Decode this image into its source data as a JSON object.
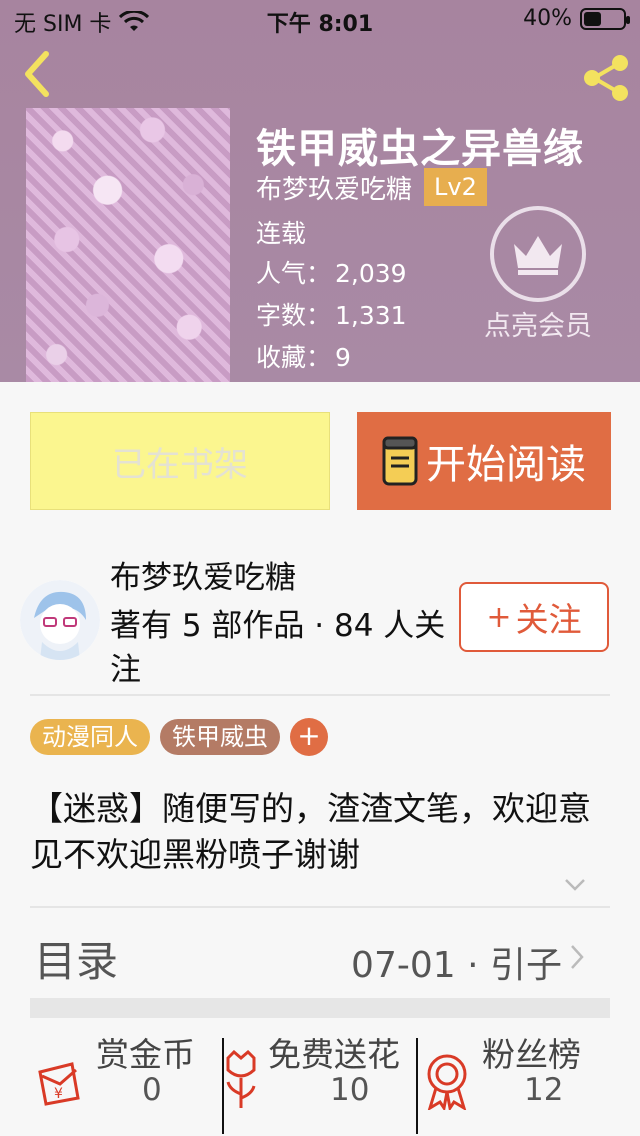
{
  "status_bar": {
    "carrier": "无 SIM 卡",
    "time": "下午 8:01",
    "battery": "40%",
    "battery_level": 0.4
  },
  "book": {
    "title": "铁甲威虫之异兽缘",
    "author": "布梦玖爱吃糖",
    "level": "Lv2",
    "status": "连载",
    "popularity_label": "人气：",
    "popularity": "2,039",
    "words_label": "字数：",
    "words": "1,331",
    "favorites_label": "收藏：",
    "favorites": "9"
  },
  "vip": {
    "label": "点亮会员"
  },
  "actions": {
    "shelf_label": "已在书架",
    "read_label": "开始阅读"
  },
  "author_section": {
    "name": "布梦玖爱吃糖",
    "desc": "著有 5 部作品 · 84 人关注",
    "follow_label": "关注",
    "follow_plus": "+"
  },
  "tags": {
    "items": [
      "动漫同人",
      "铁甲威虫"
    ],
    "add": "+"
  },
  "intro": "【迷惑】随便写的，渣渣文笔，欢迎意见不欢迎黑粉喷子谢谢",
  "toc": {
    "label": "目录",
    "latest": "07-01 · 引子"
  },
  "bottom": {
    "reward_label": "赏金币",
    "reward_value": "0",
    "flower_label": "免费送花",
    "flower_value": "10",
    "fans_label": "粉丝榜",
    "fans_value": "12"
  },
  "colors": {
    "header_bg": "#a7849f",
    "accent": "#e06d44",
    "shelf_btn": "#fbf68f",
    "tag_yellow": "#eab44f",
    "tag_brown": "#b47b65",
    "level_badge": "#e7ae4f"
  }
}
